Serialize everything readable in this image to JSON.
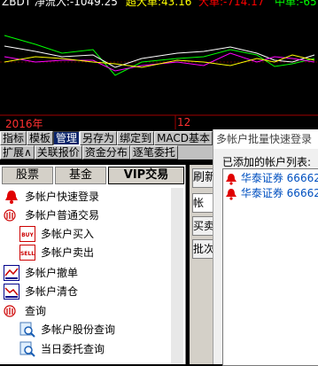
{
  "chart": {
    "title_fragment": "ZBDT 净流入:-1049.25",
    "super_large": "超大单:43.16",
    "large": "大单:-714.17",
    "medium": "中单:-65",
    "year_label": "2016年",
    "month_label": "12",
    "colors": {
      "green": "#00ff00",
      "white": "#ffffff",
      "magenta": "#ff00ff",
      "yellow": "#ffff00",
      "red": "#ff0000"
    }
  },
  "toolbar": {
    "row1": [
      "指标",
      "模板",
      "管理",
      "另存为",
      "绑定到",
      "MACD基本"
    ],
    "row2": [
      "扩展∧",
      "关联报价",
      "资金分布",
      "逐笔委托"
    ],
    "selected": "管理"
  },
  "left_panel": {
    "tabs": [
      "股票",
      "基金",
      "VIP交易"
    ],
    "items": [
      {
        "label": "多帐户快速登录",
        "icon": "bell-icon"
      },
      {
        "label": "多帐户普通交易",
        "icon": "stack-icon"
      },
      {
        "label": "多帐户买入",
        "icon": "buy-icon",
        "badge": "BUY"
      },
      {
        "label": "多帐户卖出",
        "icon": "sell-icon",
        "badge": "SELL"
      },
      {
        "label": "多帐户撤单",
        "icon": "cancel-order-icon"
      },
      {
        "label": "多帐户清仓",
        "icon": "clear-position-icon"
      },
      {
        "label": "查询",
        "icon": "stack-icon"
      },
      {
        "label": "多帐户股份查询",
        "icon": "magnifier-icon"
      },
      {
        "label": "当日委托查询",
        "icon": "magnifier-icon"
      }
    ]
  },
  "middle_panel": {
    "buttons": [
      "刷新",
      "帐",
      "买卖",
      "批次"
    ]
  },
  "dialog": {
    "title": "多帐户批量快速登录",
    "list_label": "已添加的帐户列表:",
    "accounts": [
      {
        "broker": "华泰证券",
        "id": "66662"
      },
      {
        "broker": "华泰证券",
        "id": "66662"
      }
    ]
  }
}
